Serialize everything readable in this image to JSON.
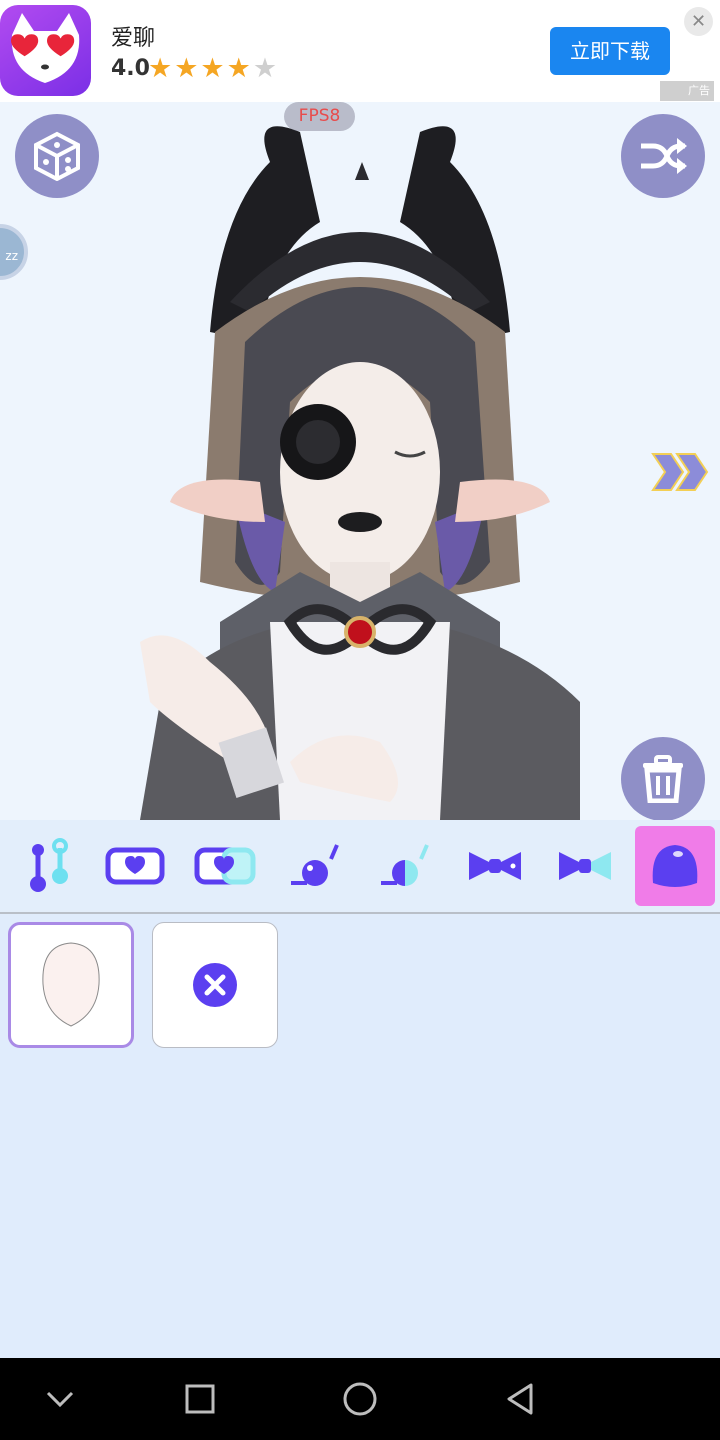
{
  "ad": {
    "app_name": "爱聊",
    "rating": "4.0",
    "stars_filled": 4,
    "stars_total": 5,
    "stars_on": "★★★★",
    "stars_off": "★",
    "download_label": "立即下载",
    "close_icon": "close-icon",
    "tag": "广告",
    "brand_color": "#1a86f0"
  },
  "stage": {
    "fps_label": "FPS8",
    "side_badge": "zz",
    "buttons": [
      "dice-icon",
      "shuffle-icon",
      "trash-icon",
      "double-chevron-right-icon"
    ]
  },
  "toolbar": {
    "categories": [
      {
        "icon": "slider-icon",
        "active": false
      },
      {
        "icon": "heart-tag-icon",
        "active": false
      },
      {
        "icon": "heart-tag-half-icon",
        "active": false
      },
      {
        "icon": "bead-pin-icon",
        "active": false
      },
      {
        "icon": "bead-pin-half-icon",
        "active": false
      },
      {
        "icon": "bowtie-icon",
        "active": false
      },
      {
        "icon": "bowtie-half-icon",
        "active": false
      },
      {
        "icon": "head-shape-icon",
        "active": true
      }
    ],
    "accent_color": "#5b3ff0",
    "active_color": "#f07ce8"
  },
  "items": [
    {
      "icon": "face-shape-icon",
      "selected": true
    },
    {
      "icon": "remove-x-icon",
      "selected": false
    }
  ],
  "navbar": {
    "buttons": [
      "chevron-down-icon",
      "square-recents-icon",
      "circle-home-icon",
      "triangle-back-icon"
    ]
  }
}
